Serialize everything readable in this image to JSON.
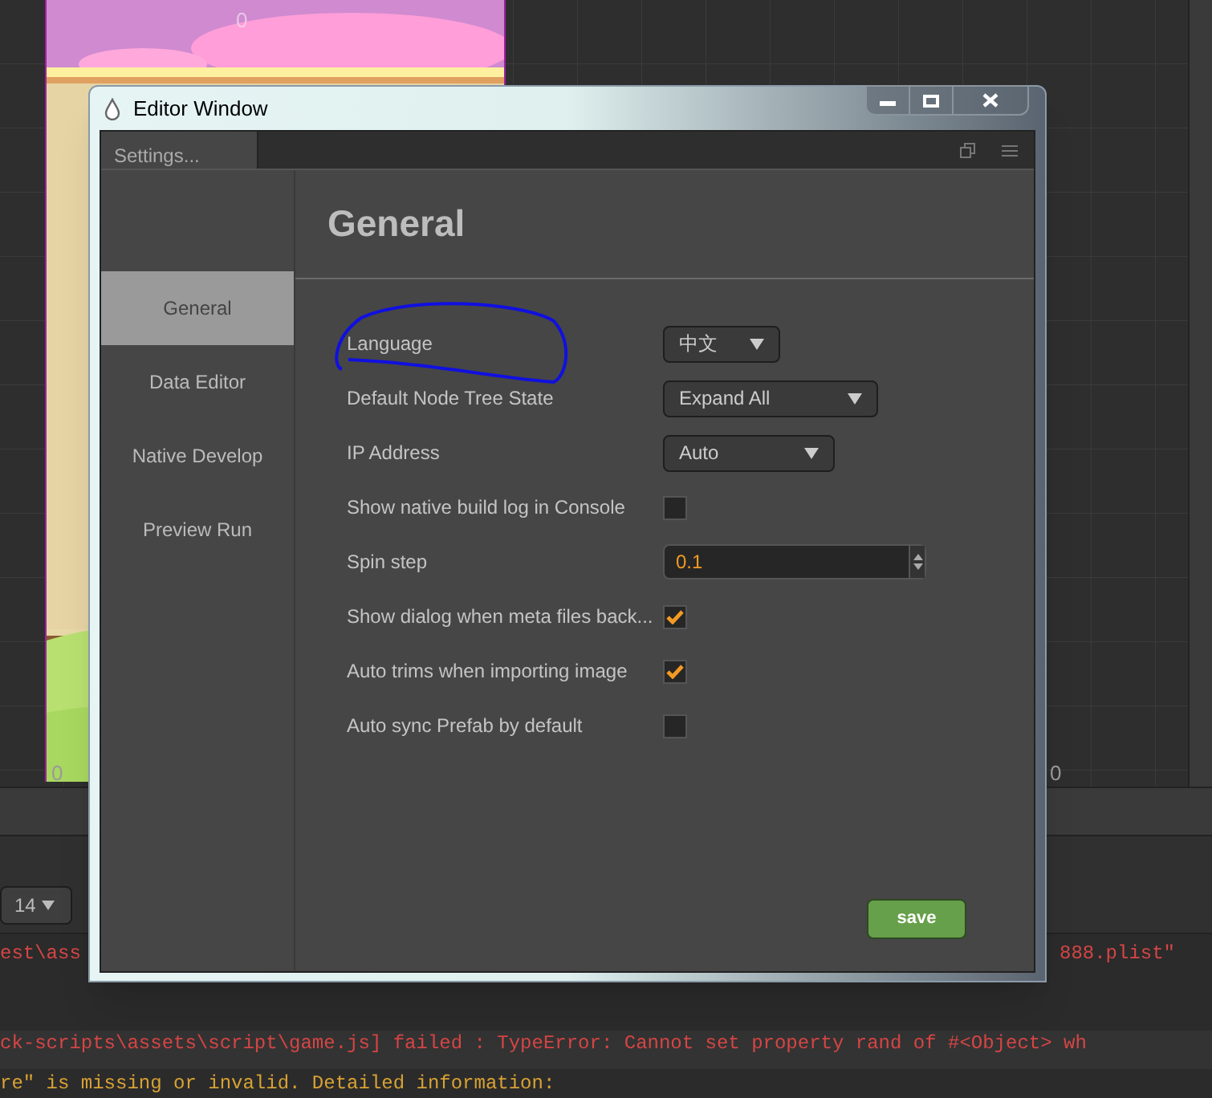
{
  "window": {
    "title": "Editor Window"
  },
  "panel_tab": {
    "label": "Settings..."
  },
  "sidebar": {
    "items": [
      {
        "label": "General",
        "selected": true
      },
      {
        "label": "Data Editor",
        "selected": false
      },
      {
        "label": "Native Develop",
        "selected": false
      },
      {
        "label": "Preview Run",
        "selected": false
      }
    ]
  },
  "content": {
    "heading": "General",
    "settings": [
      {
        "kind": "dropdown",
        "label": "Language",
        "value": "中文"
      },
      {
        "kind": "dropdown",
        "label": "Default Node Tree State",
        "value": "Expand All"
      },
      {
        "kind": "dropdown",
        "label": "IP Address",
        "value": "Auto"
      },
      {
        "kind": "checkbox",
        "label": "Show native build log in Console",
        "checked": false
      },
      {
        "kind": "number",
        "label": "Spin step",
        "value": "0.1"
      },
      {
        "kind": "checkbox",
        "label": "Show dialog when meta files back...",
        "checked": true
      },
      {
        "kind": "checkbox",
        "label": "Auto trims when importing image",
        "checked": true
      },
      {
        "kind": "checkbox",
        "label": "Auto sync Prefab by default",
        "checked": false
      }
    ]
  },
  "save_button": "save",
  "background": {
    "scene_labels": [
      "0",
      "0",
      "0"
    ],
    "zoom_dropdown": "14",
    "console": [
      {
        "left": "est\\ass",
        "right": "888.plist\"",
        "color": "#d64545"
      },
      {
        "left": "ck-scripts\\assets\\script\\game.js] failed : TypeError: Cannot set property rand of #<Object> wh",
        "color": "#d64545"
      },
      {
        "left": "re\" is missing or invalid. Detailed information:",
        "color": "#d9a233"
      }
    ]
  }
}
